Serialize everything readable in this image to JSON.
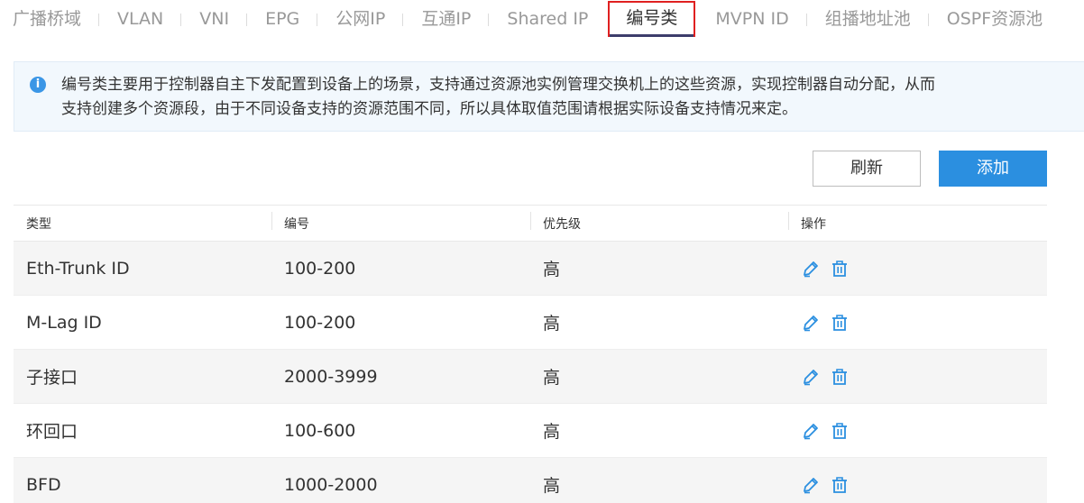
{
  "tabs": [
    {
      "label": "广播桥域",
      "active": false
    },
    {
      "label": "VLAN",
      "active": false
    },
    {
      "label": "VNI",
      "active": false
    },
    {
      "label": "EPG",
      "active": false
    },
    {
      "label": "公网IP",
      "active": false
    },
    {
      "label": "互通IP",
      "active": false
    },
    {
      "label": "Shared IP",
      "active": false
    },
    {
      "label": "编号类",
      "active": true
    },
    {
      "label": "MVPN ID",
      "active": false
    },
    {
      "label": "组播地址池",
      "active": false
    },
    {
      "label": "OSPF资源池",
      "active": false
    }
  ],
  "info": {
    "icon": "info-icon",
    "line1": "编号类主要用于控制器自主下发配置到设备上的场景，支持通过资源池实例管理交换机上的这些资源，实现控制器自动分配，从而",
    "line2": "支持创建多个资源段，由于不同设备支持的资源范围不同，所以具体取值范围请根据实际设备支持情况来定。"
  },
  "toolbar": {
    "refresh_label": "刷新",
    "add_label": "添加"
  },
  "table": {
    "headers": [
      "类型",
      "编号",
      "优先级",
      "操作"
    ],
    "rows": [
      {
        "type": "Eth-Trunk ID",
        "number": "100-200",
        "priority": "高"
      },
      {
        "type": "M-Lag ID",
        "number": "100-200",
        "priority": "高"
      },
      {
        "type": "子接口",
        "number": "2000-3999",
        "priority": "高"
      },
      {
        "type": "环回口",
        "number": "100-600",
        "priority": "高"
      },
      {
        "type": "BFD",
        "number": "1000-2000",
        "priority": "高"
      }
    ],
    "actions": {
      "edit_icon": "edit-icon",
      "delete_icon": "trash-icon"
    }
  },
  "colors": {
    "accent": "#2b8fe0",
    "active_tab_border": "#e02020",
    "active_tab_underline": "#3d3d6b",
    "info_bg": "#f2f8fd",
    "row_alt_bg": "#f5f5f5"
  }
}
